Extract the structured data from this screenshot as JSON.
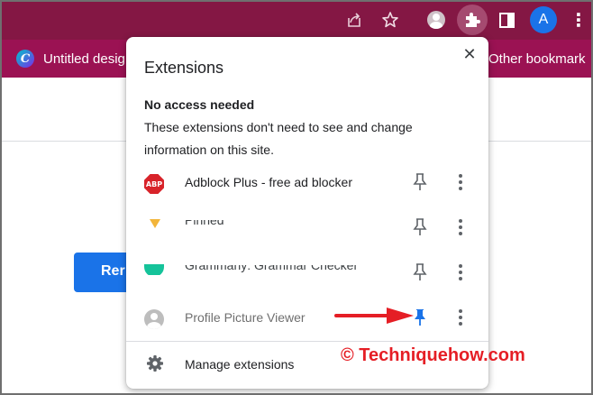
{
  "toolbar": {
    "avatar_letter": "A",
    "menu_glyph": "⋮",
    "icons": [
      "share-icon",
      "star-icon",
      "profile-icon",
      "puzzle-icon",
      "side-panel-icon",
      "avatar",
      "more-vert-icon"
    ]
  },
  "bookmarks": {
    "items": [
      {
        "label": "Untitled desig",
        "icon": "canva-logo",
        "icon_letter": "C"
      },
      {
        "label": "Other bookmark",
        "icon": null
      }
    ]
  },
  "background_page": {
    "button_label": "Rer"
  },
  "popup": {
    "title": "Extensions",
    "close_glyph": "✕",
    "section": {
      "heading": "No access needed",
      "description": "These extensions don't need to see and change information on this site."
    },
    "extensions": [
      {
        "name": "Adblock Plus - free ad blocker",
        "icon": "abp-icon",
        "icon_text": "ABP",
        "pinned": false
      },
      {
        "name": "Pinned",
        "icon": "pinned-icon",
        "pinned": false,
        "partially_hidden": true
      },
      {
        "name": "Grammarly: Grammar Checker",
        "icon": "grammarly-icon",
        "pinned": false,
        "partially_hidden": true
      },
      {
        "name": "Profile Picture Viewer",
        "icon": "profile-icon",
        "pinned": true
      }
    ],
    "manage_label": "Manage extensions"
  },
  "colors": {
    "toolbar": "#841744",
    "bookmarks_bar": "#9b1253",
    "pin_active": "#1a73e8",
    "annotation_red": "#e51e25"
  },
  "watermark": {
    "text": "© Techniquehow.com"
  }
}
